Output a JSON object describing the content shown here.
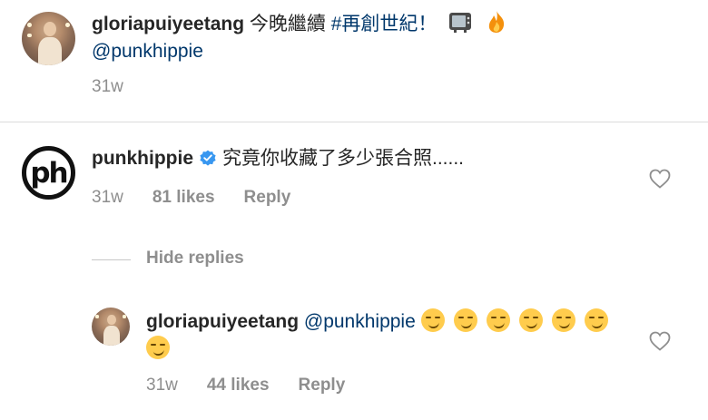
{
  "caption": {
    "username": "gloriapuiyeetang",
    "text": "今晚繼續",
    "hashtag": "#再創世紀！",
    "emojis": [
      "tv-icon",
      "fire-icon"
    ],
    "mention": "@punkhippie",
    "time": "31w"
  },
  "comment": {
    "username": "punkhippie",
    "avatar_text": "ph",
    "verified": true,
    "text": "究竟你收藏了多少張合照......",
    "time": "31w",
    "likes": "81 likes",
    "reply_label": "Reply"
  },
  "replies_toggle": {
    "label": "Hide replies"
  },
  "reply": {
    "username": "gloriapuiyeetang",
    "mention": "@punkhippie",
    "emoji": "smirking-face-icon",
    "emoji_count": 7,
    "time": "31w",
    "likes": "44 likes",
    "reply_label": "Reply"
  },
  "colors": {
    "text": "#262626",
    "secondary": "#8e8e8e",
    "link": "#00376b",
    "verified": "#3897f0",
    "divider": "#dbdbdb"
  }
}
